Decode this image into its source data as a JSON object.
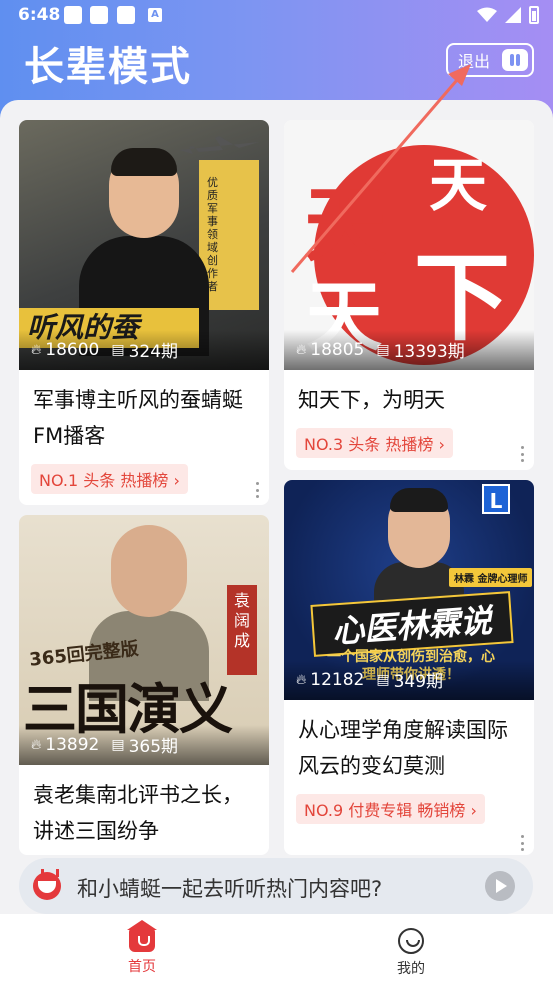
{
  "status_bar": {
    "time": "6:48",
    "notif_letter": "A"
  },
  "header": {
    "title": "长辈模式",
    "exit_label": "退出"
  },
  "cards": [
    {
      "thumb_text": "听风的蚕",
      "thumb_side_text": "优质军事领域创作者",
      "plays": "18600",
      "episodes": "324期",
      "title": "军事博主听风的蚕蜻蜓FM播客",
      "rank": "NO.1 头条 热播榜"
    },
    {
      "thumb_chars": [
        "天",
        "下",
        "天",
        "天"
      ],
      "plays": "18805",
      "episodes": "13393期",
      "title": "知天下，为明天",
      "rank": "NO.3 头条 热播榜"
    },
    {
      "thumb_sub": "365回完整版",
      "thumb_big": "三国演义",
      "thumb_tag": "袁阔成",
      "plays": "13892",
      "episodes": "365期",
      "title": "袁老集南北评书之长，讲述三国纷争"
    },
    {
      "thumb_logo": "L",
      "thumb_chip": "林霖 金牌心理师",
      "thumb_headline": "心医林霖说",
      "thumb_slogan": "一个国家从创伤到治愈，心理师带你讲透！",
      "plays": "12182",
      "episodes": "349期",
      "title": "从心理学角度解读国际风云的变幻莫测",
      "rank": "NO.9 付费专辑 畅销榜"
    }
  ],
  "promo": {
    "text": "和小蜻蜓一起去听听热门内容吧?"
  },
  "tabs": {
    "home": "首页",
    "me": "我的"
  },
  "colors": {
    "accent": "#e4393c",
    "header_start": "#5f8ff0",
    "header_end": "#a58ef3"
  }
}
